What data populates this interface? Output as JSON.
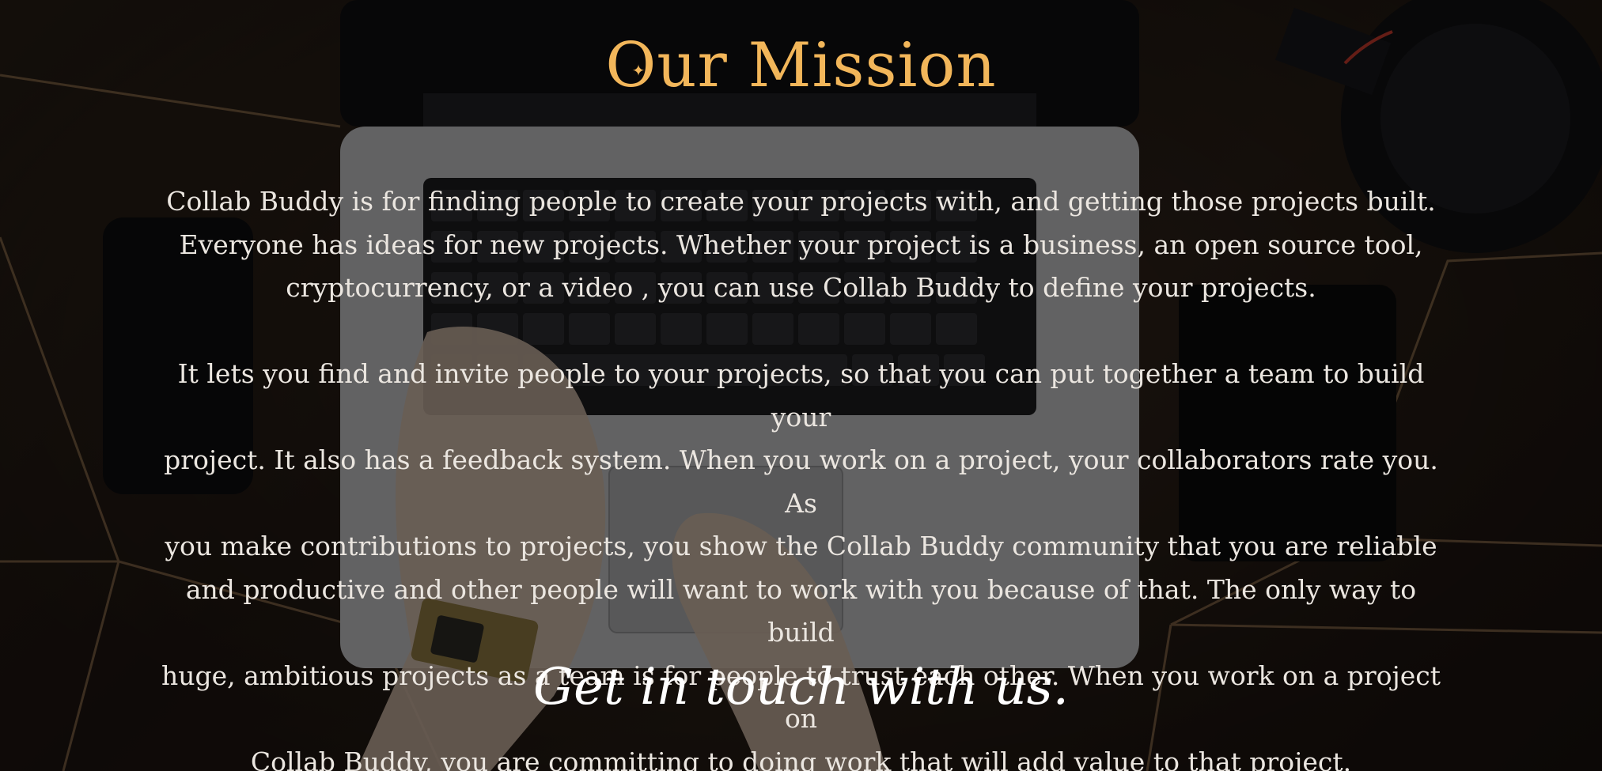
{
  "colors": {
    "title_color": "#f2b65a",
    "body_text_color": "#ebe6e0",
    "cta_color": "#ffffff",
    "overlay": "rgba(0,0,0,0.48)"
  },
  "background": {
    "icon": "laptop-desk-photo-icon"
  },
  "heading": {
    "title": "Our Mission",
    "sparkle_icon": "✦"
  },
  "mission": {
    "paragraph_1": "Collab Buddy is for finding people to create your projects with, and getting those projects built.\nEveryone has ideas for new projects. Whether your project is a business, an open source tool,\ncryptocurrency, or a video , you can use Collab Buddy  to define your projects.",
    "paragraph_2": "It lets you find and invite people to your projects, so that you can put together a team to build your\nproject. It also has a feedback system. When you work on a project, your collaborators rate you. As\nyou make contributions to projects, you show the Collab Buddy community that you are reliable\nand productive and other people will want to work with you because of that. The only way to build\nhuge, ambitious projects as a team is for people to trust each other.  When you work on  a project on\nCollab Buddy, you are committing to doing work that will add value to that project."
  },
  "contact": {
    "cta_label": "Get in touch with us."
  }
}
